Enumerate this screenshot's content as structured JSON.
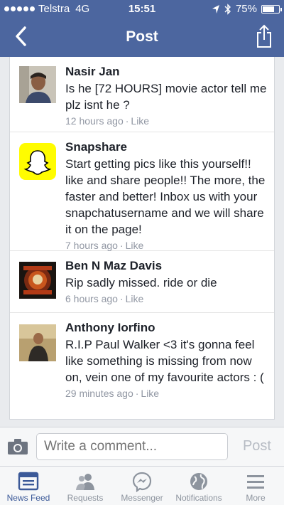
{
  "status": {
    "carrier": "Telstra",
    "network": "4G",
    "time": "15:51",
    "battery": "75%",
    "battery_level": 0.75
  },
  "nav": {
    "title": "Post"
  },
  "comments": [
    {
      "author": "Nasir Jan",
      "text": "Is he [72 HOURS] movie actor tell me plz isnt he ?",
      "time": "12 hours ago",
      "like": "Like"
    },
    {
      "author": "Snapshare",
      "text": "Start getting pics like this yourself!! like and share people!! The more, the faster and better! Inbox us with your snapchatusername and we will share it on the page!",
      "time": "7 hours ago",
      "like": "Like"
    },
    {
      "author": "Ben N Maz Davis",
      "text": "Rip sadly missed. ride or die",
      "time": "6 hours ago",
      "like": "Like"
    },
    {
      "author": "Anthony Iorfino",
      "text": "R.I.P Paul Walker <3 it's gonna feel like something is missing from now on, vein one of my favourite actors : (",
      "time": "29 minutes ago",
      "like": "Like"
    }
  ],
  "comment_bar": {
    "placeholder": "Write a comment...",
    "post_label": "Post"
  },
  "tabs": [
    {
      "label": "News Feed",
      "icon": "news-feed-icon"
    },
    {
      "label": "Requests",
      "icon": "requests-icon"
    },
    {
      "label": "Messenger",
      "icon": "messenger-icon"
    },
    {
      "label": "Notifications",
      "icon": "notifications-icon"
    },
    {
      "label": "More",
      "icon": "more-icon"
    }
  ],
  "colors": {
    "brand": "#4c669f",
    "active_tab": "#3b5998",
    "meta_text": "#9197a3"
  }
}
